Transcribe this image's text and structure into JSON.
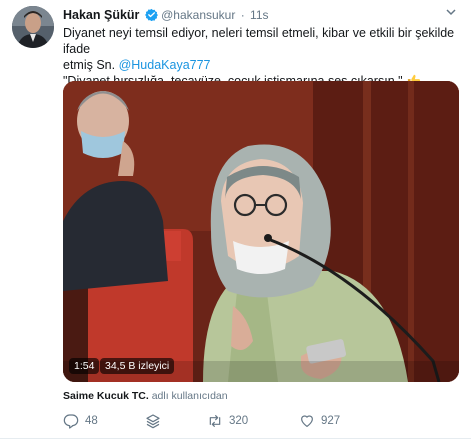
{
  "author": {
    "name": "Hakan Şükür",
    "handle": "@hakansukur",
    "time": "11s",
    "separator": "·"
  },
  "tweet": {
    "line1": "Diyanet neyi temsil ediyor, neleri temsil etmeli, kibar ve etkili bir şekilde ifade",
    "line2_prefix": "etmiş Sn. ",
    "mention": "@HudaKaya777",
    "line3": "\"Diyanet hırsızlığa, tecavüze, çocuk istismarına ses çıkarsın.\""
  },
  "video": {
    "duration": "1:54",
    "views": "34,5 B izleyici"
  },
  "attribution": {
    "user": "Saime Kucuk TC.",
    "suffix": "adlı kullanıcıdan"
  },
  "actions": {
    "replies": "48",
    "retweets": "320",
    "likes": "927"
  },
  "colors": {
    "link": "#1b95e0",
    "secondary_text": "#657786",
    "verified": "#1da1f2"
  },
  "icons": [
    "verified-badge-icon",
    "chevron-down-icon",
    "thumbs-up-icon",
    "reply-icon",
    "layers-icon",
    "retweet-icon",
    "heart-icon"
  ]
}
